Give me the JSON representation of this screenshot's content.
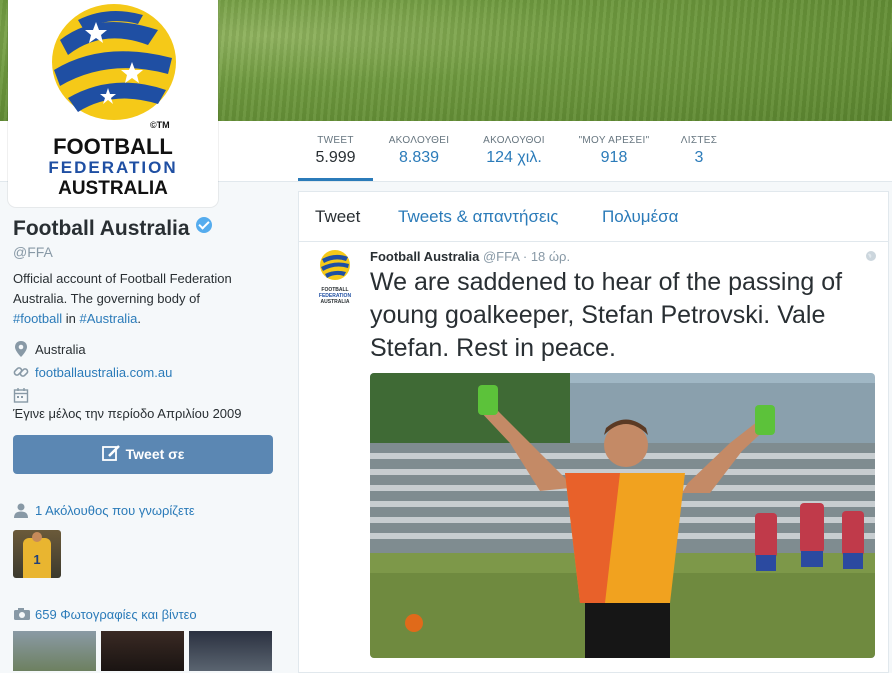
{
  "profile": {
    "name": "Football Australia",
    "handle": "@FFA",
    "bio_lines": [
      "Official account of Football Federation",
      "Australia. The governing body of"
    ],
    "bio_tag1": "#football",
    "bio_in": " in ",
    "bio_tag2": "#Australia",
    "bio_end": ".",
    "location": "Australia",
    "website": "footballaustralia.com.au",
    "joined": "Έγινε μέλος την περίοδο Απριλίου 2009",
    "tweet_to_label": "Tweet σε",
    "followers_you_know": "1 Ακόλουθος που γνωρίζετε",
    "photos_videos": "659 Φωτογραφίες και βίντεο"
  },
  "logo": {
    "line1": "FOOTBALL",
    "line2": "FEDERATION",
    "line3": "AUSTRALIA",
    "mark": "©TM"
  },
  "stats": [
    {
      "label": "TWEET",
      "value": "5.999"
    },
    {
      "label": "ΑΚΟΛΟΥΘΕΙ",
      "value": "8.839"
    },
    {
      "label": "ΑΚΟΛΟΥΘΟΙ",
      "value": "124 χιλ."
    },
    {
      "label": "\"ΜΟΥ ΑΡΕΣΕΙ\"",
      "value": "918"
    },
    {
      "label": "ΛΙΣΤΕΣ",
      "value": "3"
    }
  ],
  "tabs": [
    "Tweet",
    "Tweets & απαντήσεις",
    "Πολυμέσα"
  ],
  "tweet": {
    "author": "Football Australia",
    "handle": "@FFA",
    "sep": " · ",
    "time": "18 ώρ.",
    "text": "We are saddened to hear of the passing of young goalkeeper, Stefan Petrovski. Vale Stefan. Rest in peace.",
    "jersey_number": "1"
  },
  "colors": {
    "link": "#2b7bb9",
    "button": "#5b87b3",
    "verified": "#55acee"
  }
}
